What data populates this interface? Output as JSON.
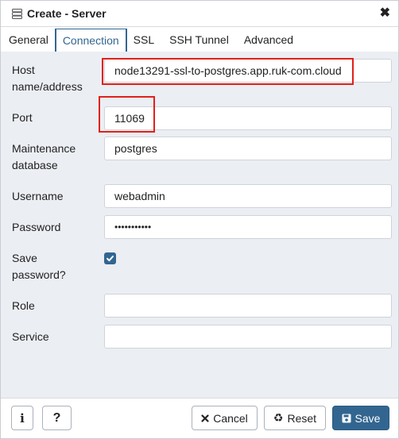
{
  "window": {
    "title": "Create - Server",
    "close_glyph": "✖"
  },
  "tabs": [
    {
      "label": "General",
      "active": false
    },
    {
      "label": "Connection",
      "active": true
    },
    {
      "label": "SSL",
      "active": false
    },
    {
      "label": "SSH Tunnel",
      "active": false
    },
    {
      "label": "Advanced",
      "active": false
    }
  ],
  "form": {
    "host": {
      "label_1": "Host",
      "label_2": "name/address",
      "value": "node13291-ssl-to-postgres.app.ruk-com.cloud",
      "highlighted": true
    },
    "port": {
      "label": "Port",
      "value": "11069",
      "highlighted": true
    },
    "maintenance_db": {
      "label_1": "Maintenance",
      "label_2": "database",
      "value": "postgres"
    },
    "username": {
      "label": "Username",
      "value": "webadmin"
    },
    "password": {
      "label": "Password",
      "value": "•••••••••••"
    },
    "save_password": {
      "label_1": "Save",
      "label_2": "password?",
      "checked": true
    },
    "role": {
      "label": "Role",
      "value": ""
    },
    "service": {
      "label": "Service",
      "value": ""
    }
  },
  "footer": {
    "info_glyph": "i",
    "help_glyph": "?",
    "cancel_label": "Cancel",
    "reset_label": "Reset",
    "save_label": "Save"
  },
  "colors": {
    "accent": "#326690",
    "highlight": "#e0211a",
    "body_bg": "#ebeef3"
  },
  "icons": [
    "server-icon",
    "close-icon",
    "info-icon",
    "help-icon",
    "cancel-icon",
    "reset-icon",
    "save-icon",
    "check-icon"
  ]
}
